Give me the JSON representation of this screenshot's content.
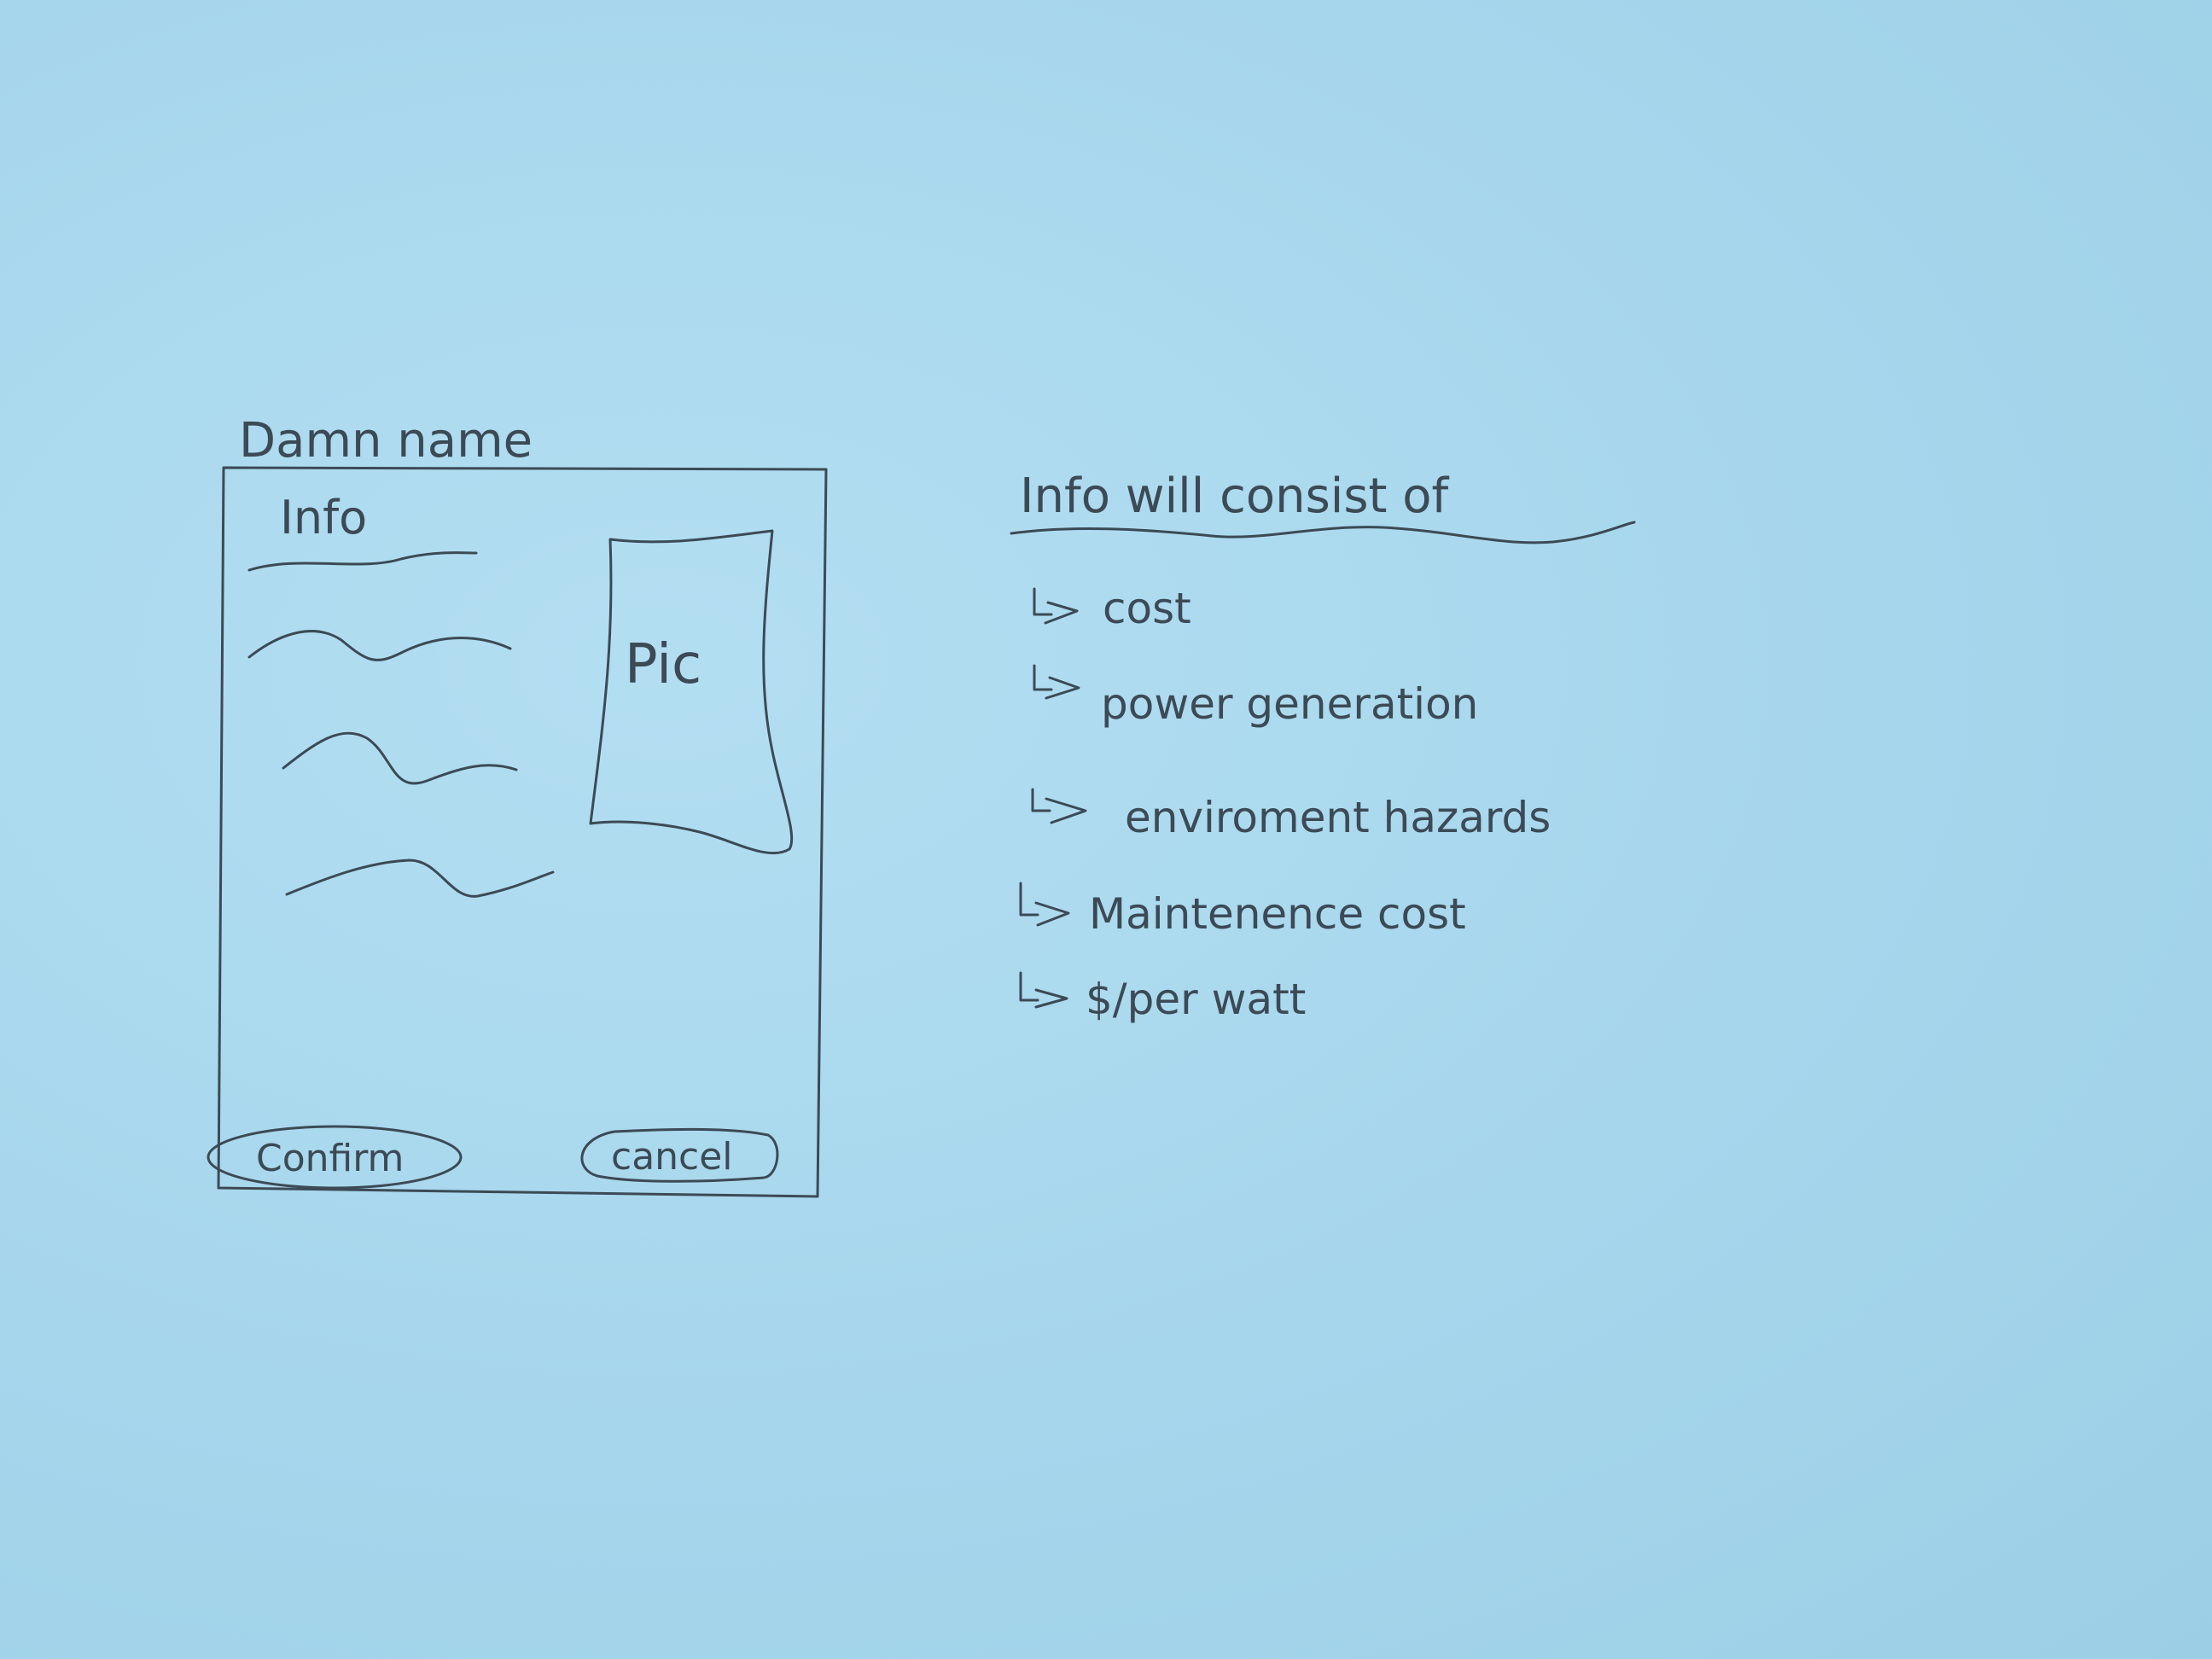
{
  "mockup": {
    "title": "Damn name",
    "info_heading": "Info",
    "pic_label": "Pic",
    "confirm_label": "Confirm",
    "cancel_label": "cancel"
  },
  "notes": {
    "heading": "Info will consist of",
    "items": [
      "cost",
      "power generation",
      "enviroment hazards",
      "Maintenence cost",
      "$/per watt"
    ]
  },
  "colors": {
    "paper": "#a8d8ee",
    "pencil": "#3c4a55"
  }
}
